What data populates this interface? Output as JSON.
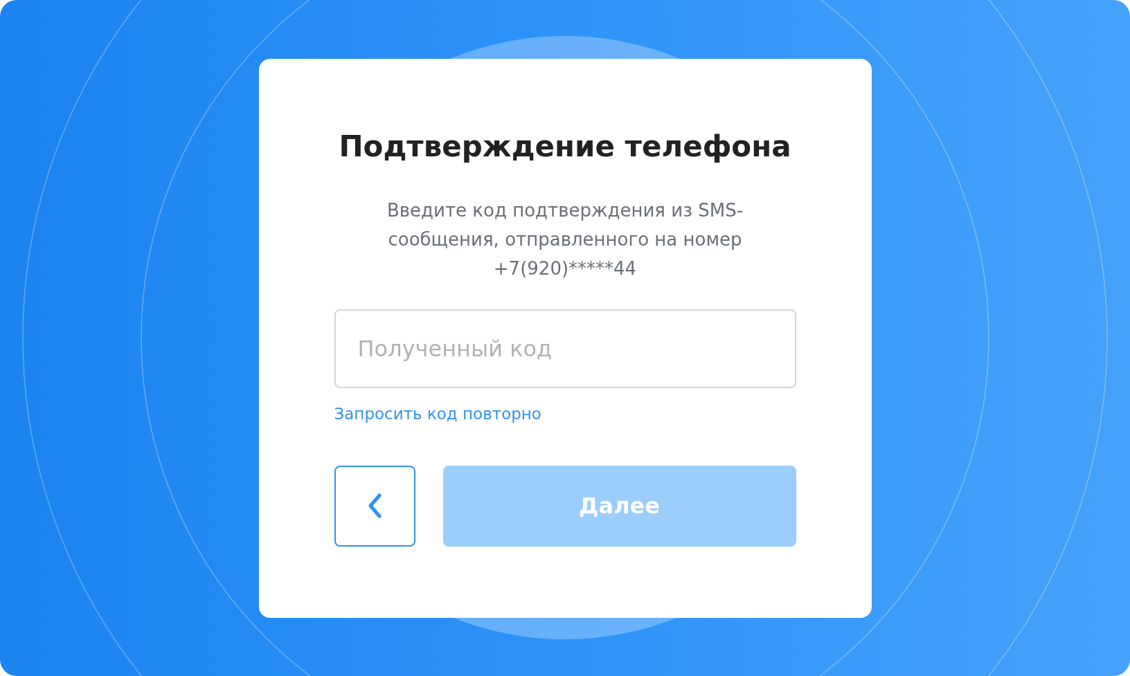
{
  "card": {
    "title": "Подтверждение телефона",
    "description": "Введите код подтверждения из SMS-сообщения, отправленного на номер +7(920)*****44",
    "code_field": {
      "placeholder": "Полученный код"
    },
    "resend_link": "Запросить код повторно",
    "next_button": {
      "label": "Далее",
      "disabled": true
    }
  }
}
